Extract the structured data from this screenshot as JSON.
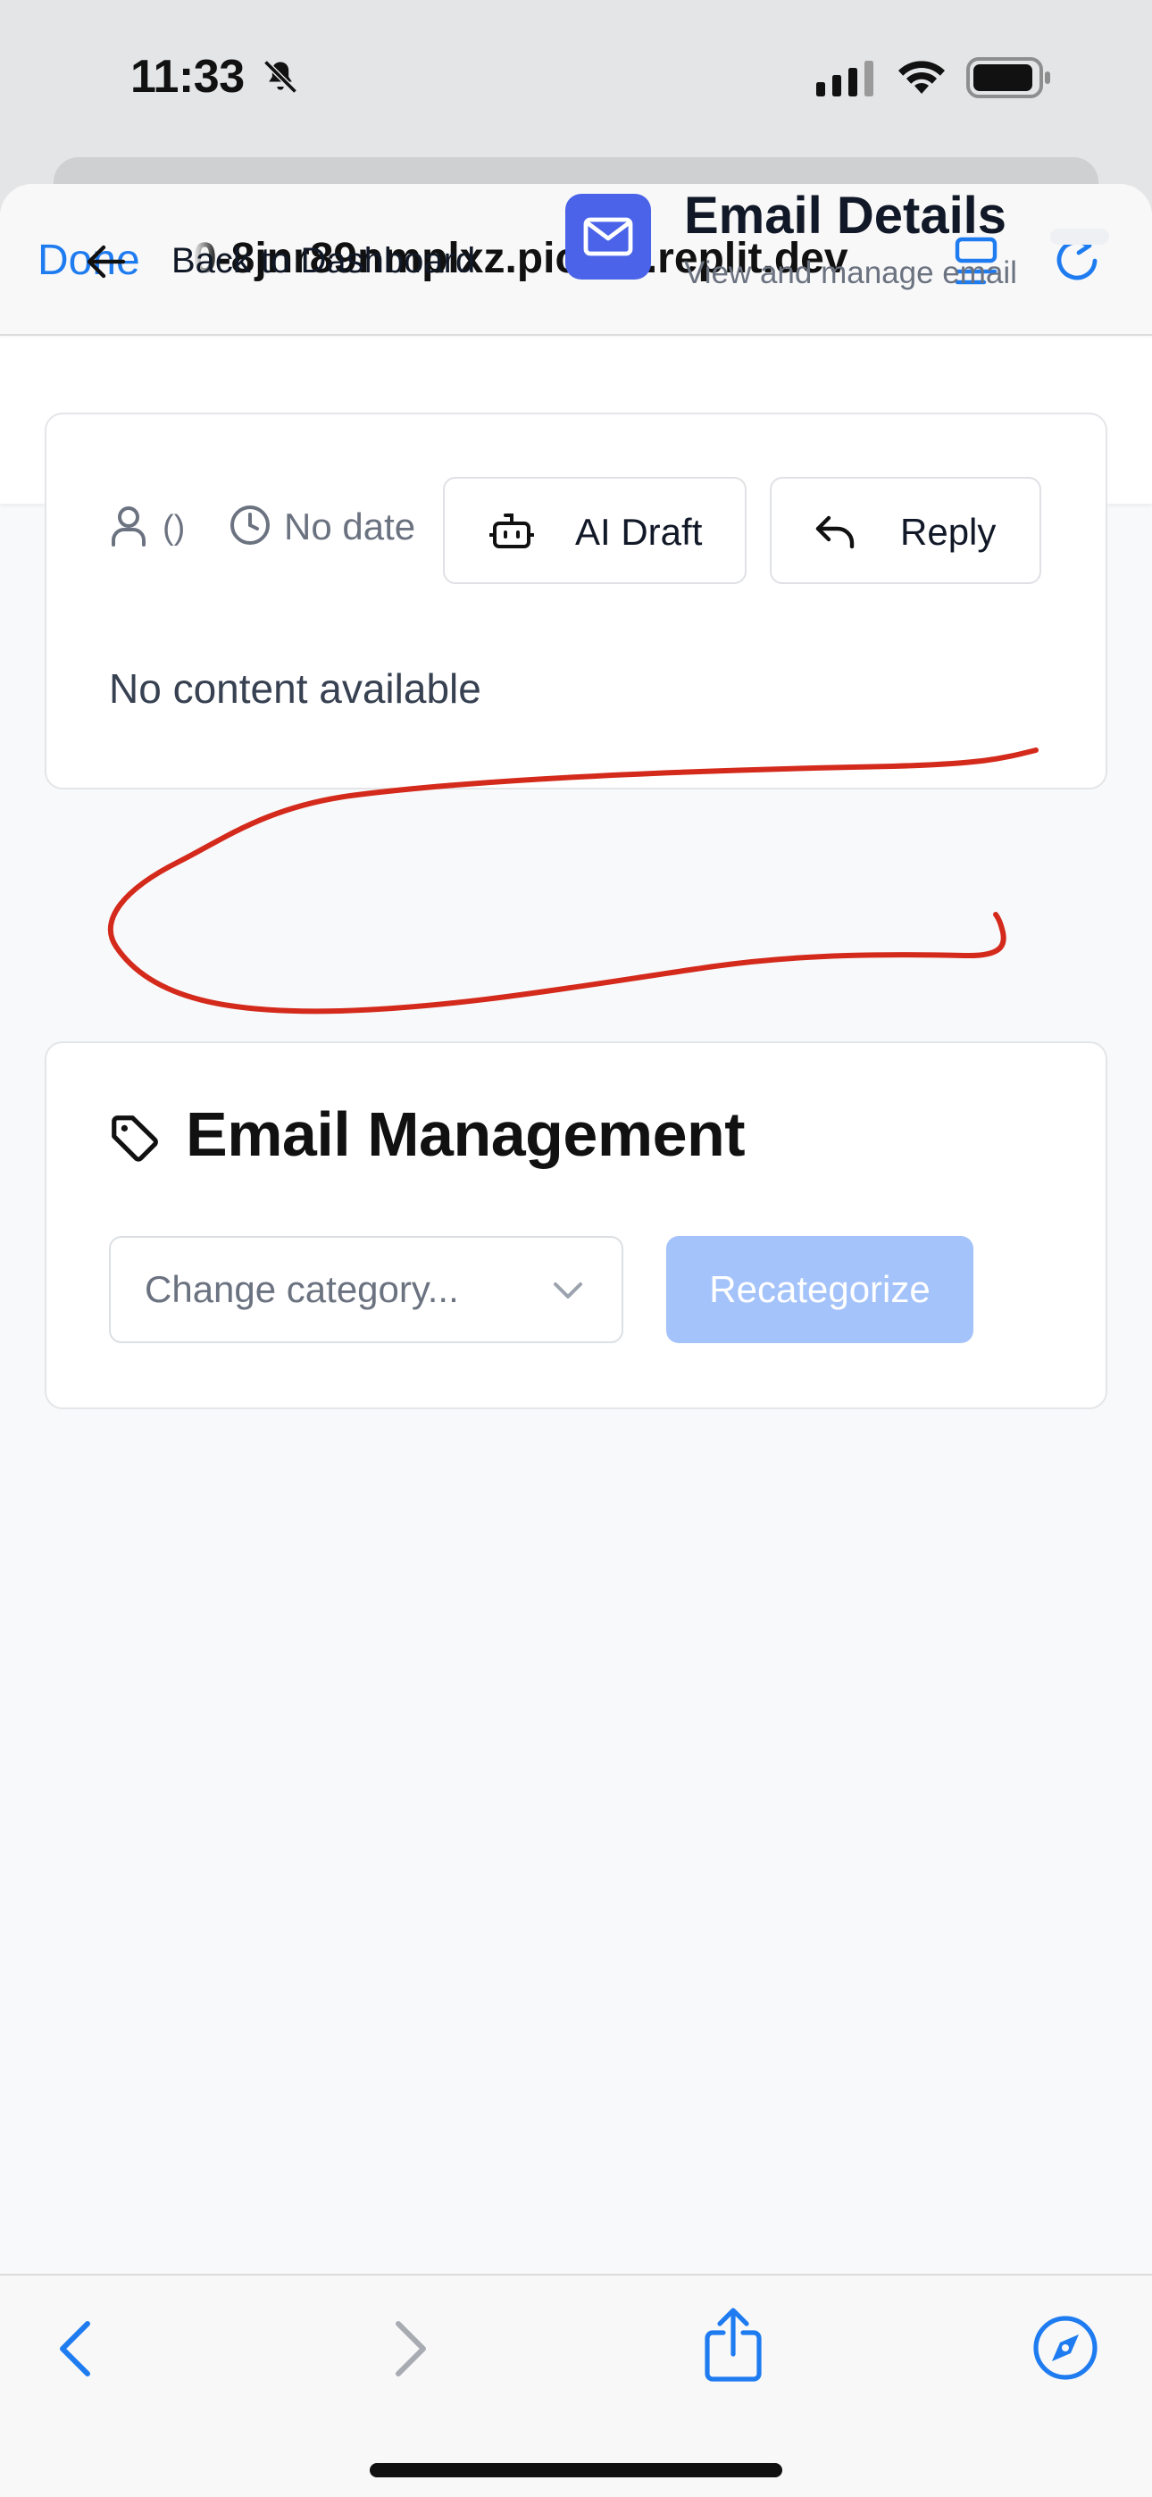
{
  "status_bar": {
    "time": "11:33",
    "icons": [
      "bell-muted-icon",
      "cellular-signal-icon",
      "wifi-icon",
      "battery-icon"
    ]
  },
  "browser": {
    "done_label": "Done",
    "url": "0-8jnr89nmplxz.picard.replit.dev",
    "icons": [
      "reader-icon",
      "reload-icon",
      "back-icon",
      "forward-icon",
      "share-icon",
      "compass-icon"
    ]
  },
  "header": {
    "back_label": "Back to Dashboard",
    "title": "Email Details",
    "subtitle": "View and manage email"
  },
  "email": {
    "sender": "()",
    "date": "No date",
    "ai_draft_label": "AI Draft",
    "reply_label": "Reply",
    "content": "No content available"
  },
  "management": {
    "title": "Email Management",
    "category_placeholder": "Change category...",
    "recategorize_label": "Recategorize"
  },
  "colors": {
    "accent": "#1f7cf0",
    "brand_badge": "#4a63e8",
    "disabled_button": "#a4c3fb",
    "annotation": "#d42a1c"
  }
}
